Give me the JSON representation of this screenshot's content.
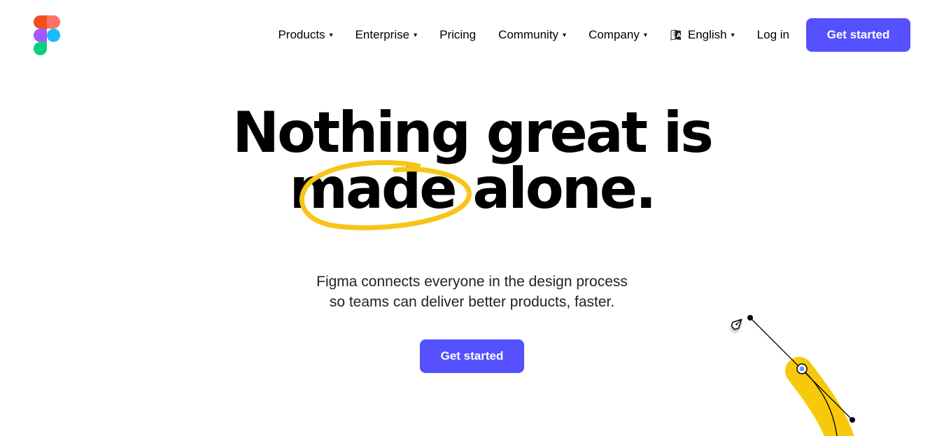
{
  "brand": {
    "name": "Figma",
    "accent_color": "#5551ff",
    "highlight_color": "#f5c518"
  },
  "nav": {
    "items": [
      {
        "label": "Products",
        "has_dropdown": true
      },
      {
        "label": "Enterprise",
        "has_dropdown": true
      },
      {
        "label": "Pricing",
        "has_dropdown": false
      },
      {
        "label": "Community",
        "has_dropdown": true
      },
      {
        "label": "Company",
        "has_dropdown": true
      }
    ],
    "language": {
      "icon": "translate-icon",
      "label": "English"
    },
    "login_label": "Log in",
    "cta_label": "Get started",
    "caret": "▾"
  },
  "hero": {
    "title_line1": "Nothing great is",
    "title_line2": "made alone.",
    "subtitle_line1": "Figma connects everyone in the design process",
    "subtitle_line2": "so teams can deliver better products, faster.",
    "cta_label": "Get started"
  }
}
